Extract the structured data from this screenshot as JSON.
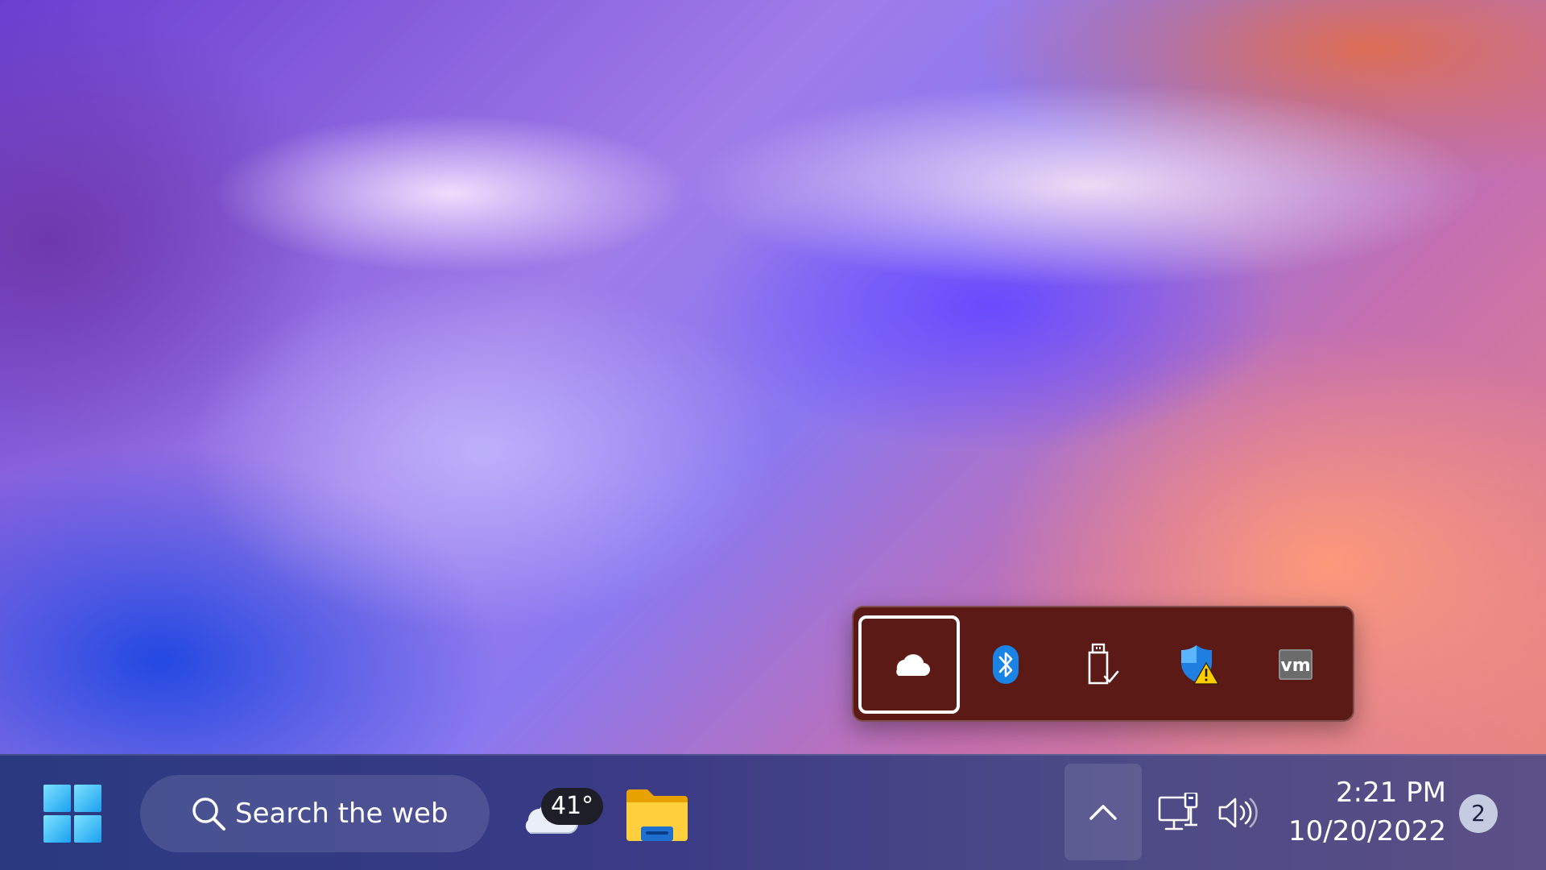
{
  "desktop": {
    "wallpaper": "abstract-gradient-wallpaper"
  },
  "tray_flyout": {
    "items": [
      {
        "name": "OneDrive",
        "icon": "onedrive-cloud-icon",
        "focused": true
      },
      {
        "name": "Bluetooth",
        "icon": "bluetooth-icon",
        "focused": false
      },
      {
        "name": "Safely Remove Hardware",
        "icon": "usb-eject-icon",
        "focused": false
      },
      {
        "name": "Windows Security",
        "icon": "security-warning-icon",
        "focused": false
      },
      {
        "name": "VMware",
        "icon": "vmware-icon",
        "focused": false
      }
    ]
  },
  "taskbar": {
    "start_icon": "windows-logo-icon",
    "search": {
      "label": "Search the web",
      "icon": "search-icon"
    },
    "weather": {
      "temperature": "41°",
      "icon": "cloud-icon"
    },
    "pinned": [
      {
        "name": "File Explorer",
        "icon": "folder-icon"
      }
    ],
    "tray": {
      "show_hidden_icon": "chevron-up-icon",
      "network_icon": "network-icon",
      "volume_icon": "volume-icon"
    },
    "clock": {
      "time": "2:21 PM",
      "date": "10/20/2022"
    },
    "notifications": {
      "count": "2"
    }
  },
  "colors": {
    "flyout_background": "#5b1a16",
    "bluetooth_blue": "#1a84e6",
    "taskbar_start": "#2a3a80",
    "taskbar_end": "#5c4f86"
  }
}
